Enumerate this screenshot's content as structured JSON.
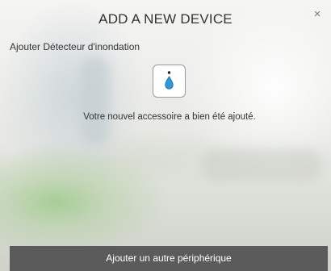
{
  "modal": {
    "title": "ADD A NEW DEVICE",
    "close_label": "×",
    "subtitle": "Ajouter Détecteur d'inondation",
    "device_icon": "water-drop-icon",
    "message": "Votre nouvel accessoire a bien été ajouté.",
    "add_another_label": "Ajouter un autre périphérique"
  },
  "colors": {
    "drop_blue": "#2f9ad8",
    "button_bg": "#5b5b5b",
    "button_text": "#ffffff"
  }
}
